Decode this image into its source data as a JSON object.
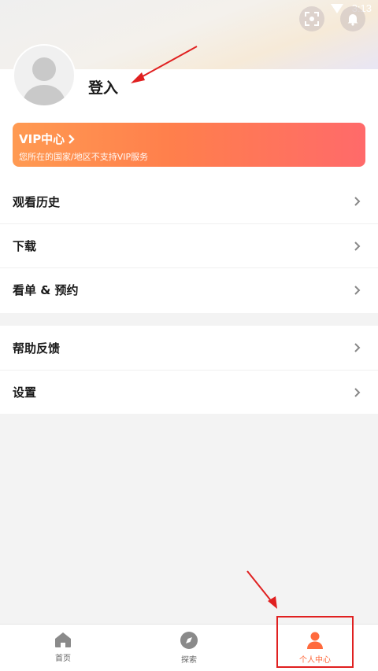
{
  "status_bar": {
    "time": "3:13"
  },
  "header": {
    "scan_icon": "scan-icon",
    "bell_icon": "bell-icon"
  },
  "profile": {
    "login_label": "登入"
  },
  "vip": {
    "title": "VIP中心",
    "subtitle": "您所在的国家/地区不支持VIP服务"
  },
  "menu_group_1": [
    {
      "label": "观看历史"
    },
    {
      "label": "下载"
    },
    {
      "label": "看单 & 预约"
    }
  ],
  "menu_group_2": [
    {
      "label": "帮助反馈"
    },
    {
      "label": "设置"
    }
  ],
  "bottom_nav": [
    {
      "label": "首页",
      "icon": "home-icon",
      "active": false
    },
    {
      "label": "探索",
      "icon": "compass-icon",
      "active": false
    },
    {
      "label": "个人中心",
      "icon": "person-icon",
      "active": true
    }
  ],
  "colors": {
    "accent": "#ff6a3d",
    "annotation_red": "#e02020"
  }
}
